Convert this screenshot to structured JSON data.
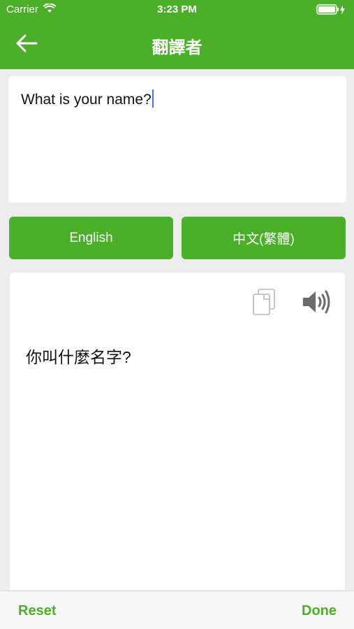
{
  "status_bar": {
    "carrier": "Carrier",
    "time": "3:23 PM",
    "wifi_icon": "wifi-icon",
    "battery_icon": "battery-icon"
  },
  "nav": {
    "title": "翻譯者",
    "back_icon": "back-arrow-icon"
  },
  "input": {
    "text": "What is your name?"
  },
  "languages": {
    "source": "English",
    "target": "中文(繁體)"
  },
  "output": {
    "translation": "你叫什麼名字?",
    "copy_icon": "copy-icon",
    "speaker_icon": "speaker-icon"
  },
  "bottom_bar": {
    "reset_label": "Reset",
    "done_label": "Done"
  },
  "colors": {
    "brand_green": "#4caf2a",
    "background": "#ececec",
    "caret": "#3b6cf6"
  }
}
